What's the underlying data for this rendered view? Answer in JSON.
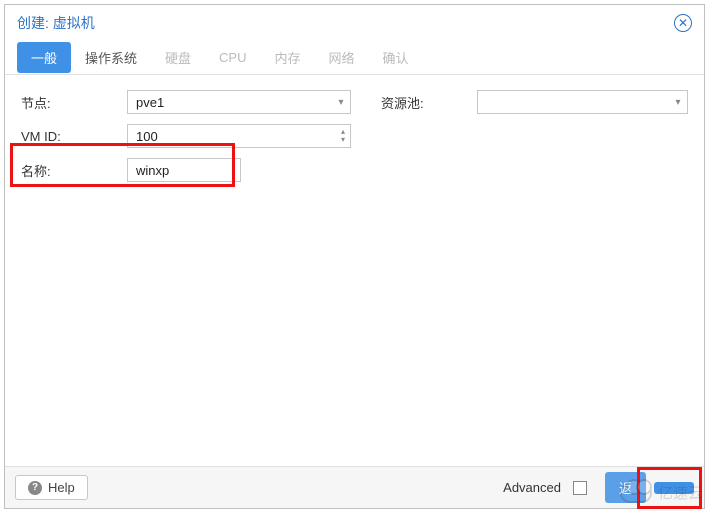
{
  "dialog": {
    "title": "创建: 虚拟机"
  },
  "tabs": [
    {
      "label": "一般",
      "active": true,
      "disabled": false
    },
    {
      "label": "操作系统",
      "active": false,
      "disabled": false
    },
    {
      "label": "硬盘",
      "active": false,
      "disabled": true
    },
    {
      "label": "CPU",
      "active": false,
      "disabled": true
    },
    {
      "label": "内存",
      "active": false,
      "disabled": true
    },
    {
      "label": "网络",
      "active": false,
      "disabled": true
    },
    {
      "label": "确认",
      "active": false,
      "disabled": true
    }
  ],
  "form": {
    "node": {
      "label": "节点:",
      "value": "pve1"
    },
    "vmid": {
      "label": "VM ID:",
      "value": "100"
    },
    "name": {
      "label": "名称:",
      "value": "winxp"
    },
    "pool": {
      "label": "资源池:",
      "value": ""
    }
  },
  "footer": {
    "help": "Help",
    "advanced": "Advanced",
    "back": "返",
    "next": ""
  },
  "watermark": "亿速云"
}
